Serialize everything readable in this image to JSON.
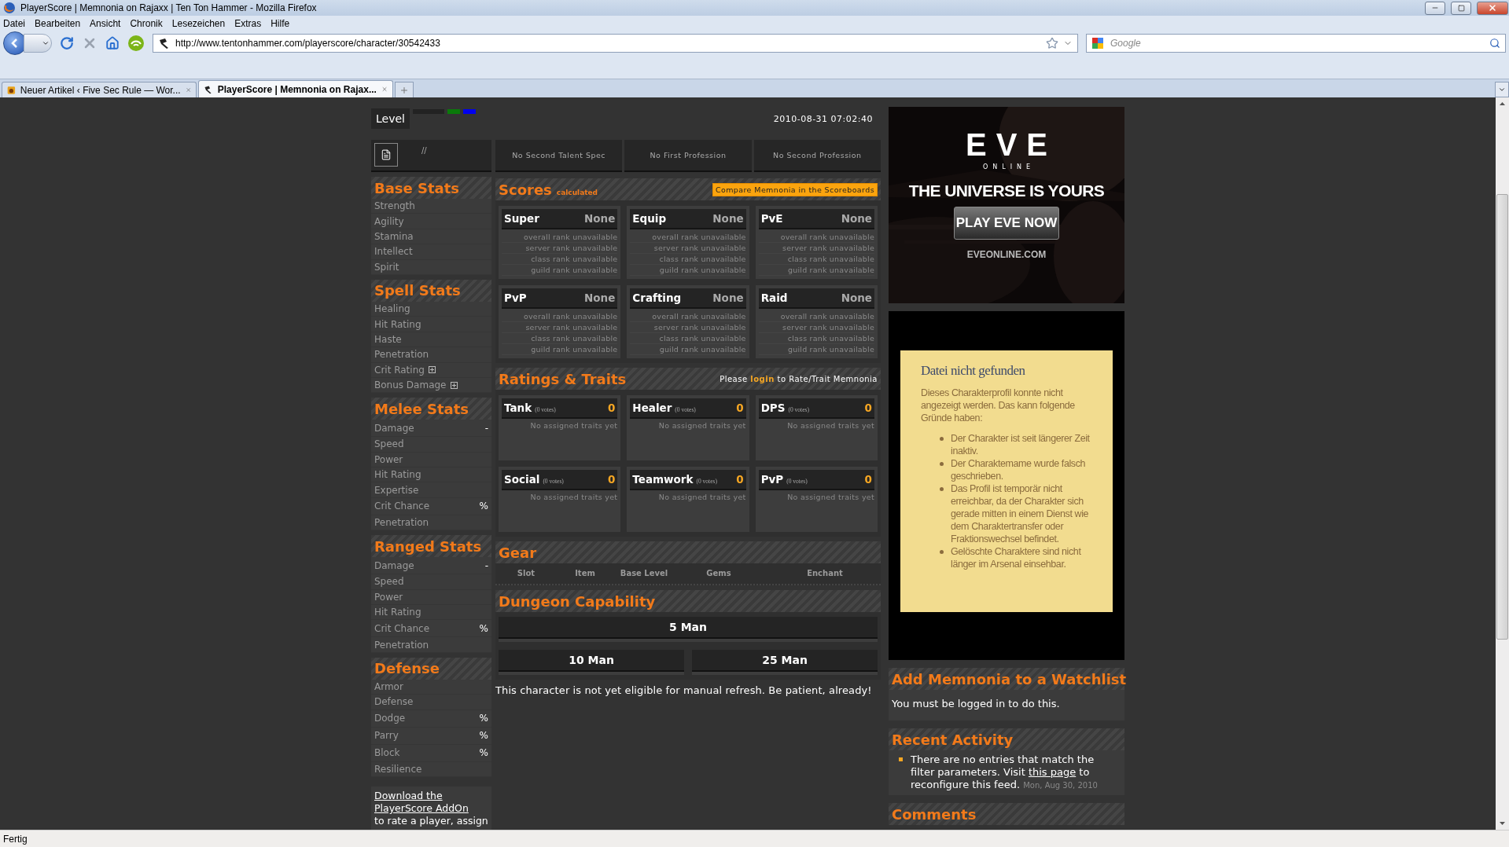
{
  "window": {
    "title": "PlayerScore | Memnonia on Rajaxx | Ten Ton Hammer - Mozilla Firefox"
  },
  "menu": [
    "Datei",
    "Bearbeiten",
    "Ansicht",
    "Chronik",
    "Lesezeichen",
    "Extras",
    "Hilfe"
  ],
  "address": {
    "url": "http://www.tentonhammer.com/playerscore/character/30542433"
  },
  "search": {
    "placeholder": "Google"
  },
  "tabs": [
    {
      "label": "Neuer Artikel ‹ Five Sec Rule — Wor...",
      "selected": false
    },
    {
      "label": "PlayerScore | Memnonia on Rajax...",
      "selected": true
    }
  ],
  "profile": {
    "level_label": "Level",
    "indicators": [
      {
        "color": "#0a7a0a"
      },
      {
        "color": "#0000ee"
      }
    ],
    "timestamp": "2010-08-31 07:02:40",
    "spec": "//",
    "boxes": [
      "No Second Talent Spec",
      "No First Profession",
      "No Second Profession"
    ]
  },
  "stat_sections": [
    {
      "title": "Base Stats",
      "rows": [
        {
          "label": "Strength",
          "expandable": false
        },
        {
          "label": "Agility",
          "expandable": false
        },
        {
          "label": "Stamina",
          "expandable": false
        },
        {
          "label": "Intellect",
          "expandable": false
        },
        {
          "label": "Spirit",
          "expandable": false
        }
      ]
    },
    {
      "title": "Spell Stats",
      "rows": [
        {
          "label": "Healing",
          "expandable": false
        },
        {
          "label": "Hit Rating",
          "expandable": false
        },
        {
          "label": "Haste",
          "expandable": false
        },
        {
          "label": "Penetration",
          "expandable": false
        },
        {
          "label": "Crit Rating",
          "expandable": true
        },
        {
          "label": "Bonus Damage",
          "expandable": true
        }
      ]
    },
    {
      "title": "Melee Stats",
      "rows": [
        {
          "label": "Damage",
          "value": "-",
          "expandable": false
        },
        {
          "label": "Speed",
          "expandable": false
        },
        {
          "label": "Power",
          "expandable": false
        },
        {
          "label": "Hit Rating",
          "expandable": false
        },
        {
          "label": "Expertise",
          "expandable": false
        },
        {
          "label": "Crit Chance",
          "value": "%",
          "expandable": false
        },
        {
          "label": "Penetration",
          "expandable": false
        }
      ]
    },
    {
      "title": "Ranged Stats",
      "rows": [
        {
          "label": "Damage",
          "value": "-",
          "expandable": false
        },
        {
          "label": "Speed",
          "expandable": false
        },
        {
          "label": "Power",
          "expandable": false
        },
        {
          "label": "Hit Rating",
          "expandable": false
        },
        {
          "label": "Crit Chance",
          "value": "%",
          "expandable": false
        },
        {
          "label": "Penetration",
          "expandable": false
        }
      ]
    },
    {
      "title": "Defense",
      "rows": [
        {
          "label": "Armor",
          "expandable": false
        },
        {
          "label": "Defense",
          "expandable": false
        },
        {
          "label": "Dodge",
          "value": "%",
          "expandable": false
        },
        {
          "label": "Parry",
          "value": "%",
          "expandable": false
        },
        {
          "label": "Block",
          "value": "%",
          "expandable": false
        },
        {
          "label": "Resilience",
          "expandable": false
        }
      ]
    }
  ],
  "addon_note": {
    "link": "Download the PlayerScore AddOn",
    "text": "to rate a player, assign"
  },
  "scores": {
    "title": "Scores",
    "subtitle": "calculated",
    "compare_button": "Compare Memnonia in the Scoreboards",
    "cards": [
      {
        "name": "Super",
        "value": "None",
        "ranks": [
          "overall rank unavailable",
          "server rank unavailable",
          "class rank unavailable",
          "guild rank unavailable"
        ]
      },
      {
        "name": "Equip",
        "value": "None",
        "ranks": [
          "overall rank unavailable",
          "server rank unavailable",
          "class rank unavailable",
          "guild rank unavailable"
        ]
      },
      {
        "name": "PvE",
        "value": "None",
        "ranks": [
          "overall rank unavailable",
          "server rank unavailable",
          "class rank unavailable",
          "guild rank unavailable"
        ]
      },
      {
        "name": "PvP",
        "value": "None",
        "ranks": [
          "overall rank unavailable",
          "server rank unavailable",
          "class rank unavailable",
          "guild rank unavailable"
        ]
      },
      {
        "name": "Crafting",
        "value": "None",
        "ranks": [
          "overall rank unavailable",
          "server rank unavailable",
          "class rank unavailable",
          "guild rank unavailable"
        ]
      },
      {
        "name": "Raid",
        "value": "None",
        "ranks": [
          "overall rank unavailable",
          "server rank unavailable",
          "class rank unavailable",
          "guild rank unavailable"
        ]
      }
    ]
  },
  "ratings": {
    "title": "Ratings & Traits",
    "login_prompt": {
      "before": "Please",
      "link": "login",
      "after": "to Rate/Trait Memnonia"
    },
    "cards": [
      {
        "name": "Tank",
        "votes": "(0 votes)",
        "score": "0",
        "traits": "No assigned traits yet"
      },
      {
        "name": "Healer",
        "votes": "(0 votes)",
        "score": "0",
        "traits": "No assigned traits yet"
      },
      {
        "name": "DPS",
        "votes": "(0 votes)",
        "score": "0",
        "traits": "No assigned traits yet"
      },
      {
        "name": "Social",
        "votes": "(0 votes)",
        "score": "0",
        "traits": "No assigned traits yet"
      },
      {
        "name": "Teamwork",
        "votes": "(0 votes)",
        "score": "0",
        "traits": "No assigned traits yet"
      },
      {
        "name": "PvP",
        "votes": "(0 votes)",
        "score": "0",
        "traits": "No assigned traits yet"
      }
    ]
  },
  "gear": {
    "title": "Gear",
    "columns": [
      "Slot",
      "Item",
      "Base Level",
      "Gems",
      "Enchant"
    ]
  },
  "dungeon": {
    "title": "Dungeon Capability",
    "rows": [
      [
        "5 Man"
      ],
      [
        "10 Man",
        "25 Man"
      ]
    ]
  },
  "refresh_note": "This character is not yet eligible for manual refresh. Be patient, already!",
  "ad": {
    "logo": "EVE",
    "logo_sub": "ONLINE",
    "heading": "THE UNIVERSE IS YOURS",
    "button": "PLAY EVE NOW",
    "site": "EVEONLINE.COM"
  },
  "error_box": {
    "title": "Datei nicht gefunden",
    "intro": "Dieses Charakterprofil konnte nicht angezeigt werden. Das kann folgende Gründe haben:",
    "reasons": [
      "Der Charakter ist seit längerer Zeit inaktiv.",
      "Der Charaktemame wurde falsch geschrieben.",
      "Das Profil ist temporär nicht erreichbar, da der Charakter sich gerade mitten in einem Dienst wie dem Charaktertransfer oder Fraktionswechsel befindet.",
      "Gelöschte Charaktere sind nicht länger im Arsenal einsehbar."
    ]
  },
  "watchlist": {
    "title": "Add Memnonia to a Watchlist",
    "text": "You must be logged in to do this."
  },
  "recent": {
    "title": "Recent Activity",
    "items": [
      {
        "before": "There are no entries that match the filter parameters. Visit",
        "link": "this page",
        "after": "to reconfigure this feed.",
        "date": "Mon, Aug 30, 2010"
      }
    ]
  },
  "comments": {
    "title": "Comments"
  },
  "status_bar": "Fertig"
}
